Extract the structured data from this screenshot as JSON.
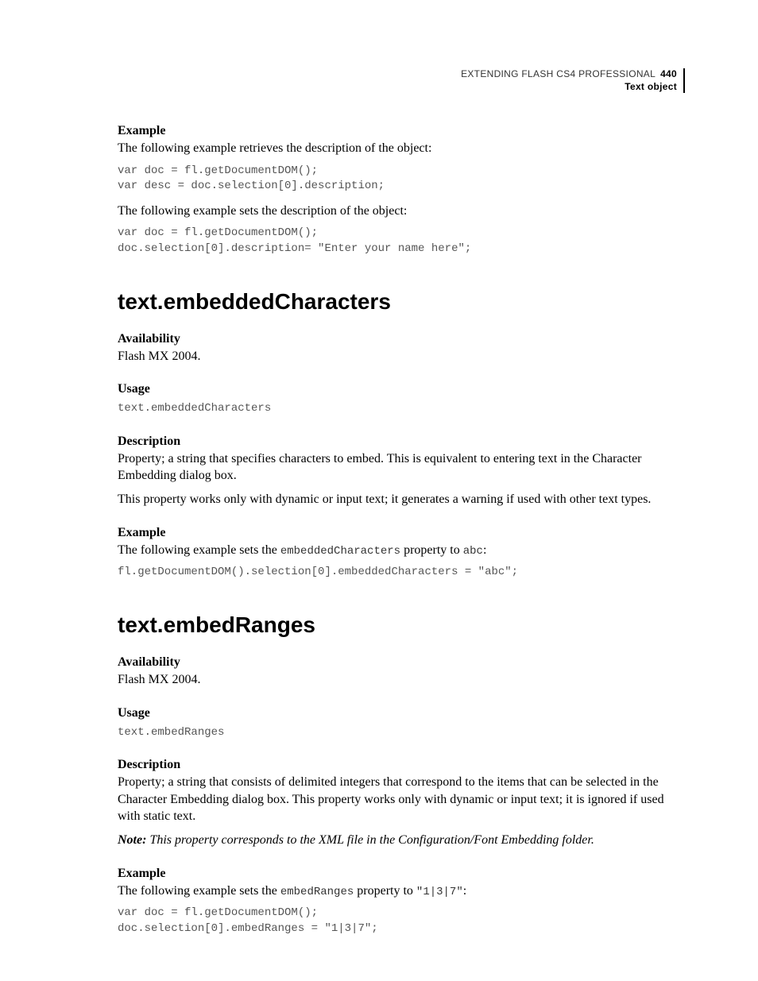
{
  "header": {
    "book_title": "EXTENDING FLASH CS4 PROFESSIONAL",
    "page_number": "440",
    "section_name": "Text object"
  },
  "s0": {
    "h_example": "Example",
    "p1": "The following example retrieves the description of the object:",
    "code1": "var doc = fl.getDocumentDOM();\nvar desc = doc.selection[0].description;",
    "p2": "The following example sets the description of the object:",
    "code2": "var doc = fl.getDocumentDOM();\ndoc.selection[0].description= \"Enter your name here\";"
  },
  "s1": {
    "title": "text.embeddedCharacters",
    "h_avail": "Availability",
    "avail_text": "Flash MX 2004.",
    "h_usage": "Usage",
    "usage_code": "text.embeddedCharacters",
    "h_desc": "Description",
    "desc_p1": "Property; a string that specifies characters to embed. This is equivalent to entering text in the Character Embedding dialog box.",
    "desc_p2": "This property works only with dynamic or input text; it generates a warning if used with other text types.",
    "h_example": "Example",
    "ex_pre": "The following example sets the ",
    "ex_code_inline": "embeddedCharacters",
    "ex_mid": " property to ",
    "ex_val": "abc",
    "ex_post": ":",
    "code": "fl.getDocumentDOM().selection[0].embeddedCharacters = \"abc\";"
  },
  "s2": {
    "title": "text.embedRanges",
    "h_avail": "Availability",
    "avail_text": "Flash MX 2004.",
    "h_usage": "Usage",
    "usage_code": "text.embedRanges",
    "h_desc": "Description",
    "desc_p1": "Property; a string that consists of delimited integers that correspond to the items that can be selected in the Character Embedding dialog box. This property works only with dynamic or input text; it is ignored if used with static text.",
    "note_label": "Note:",
    "note_text": " This property corresponds to the XML file in the Configuration/Font Embedding folder.",
    "h_example": "Example",
    "ex_pre": "The following example sets the ",
    "ex_code_inline": "embedRanges",
    "ex_mid": " property to ",
    "ex_val": "\"1|3|7\"",
    "ex_post": ":",
    "code": "var doc = fl.getDocumentDOM();\ndoc.selection[0].embedRanges = \"1|3|7\";"
  }
}
